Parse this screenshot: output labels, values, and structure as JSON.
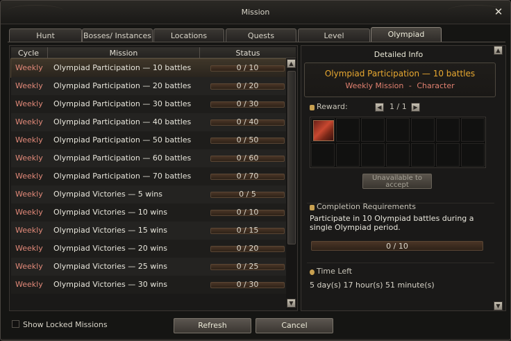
{
  "window": {
    "title": "Mission",
    "close_icon": "close-icon"
  },
  "tabs": [
    {
      "label": "Hunt",
      "active": false
    },
    {
      "label": "Bosses/ Instances",
      "active": false
    },
    {
      "label": "Locations",
      "active": false
    },
    {
      "label": "Quests",
      "active": false
    },
    {
      "label": "Level",
      "active": false
    },
    {
      "label": "Olympiad",
      "active": true
    }
  ],
  "table": {
    "columns": [
      "Cycle",
      "Mission",
      "Status"
    ],
    "rows": [
      {
        "cycle": "Weekly",
        "mission": "Olympiad Participation — 10 battles",
        "status": "0 / 10",
        "progress": 0
      },
      {
        "cycle": "Weekly",
        "mission": "Olympiad Participation — 20 battles",
        "status": "0 / 20",
        "progress": 0
      },
      {
        "cycle": "Weekly",
        "mission": "Olympiad Participation — 30 battles",
        "status": "0 / 30",
        "progress": 0
      },
      {
        "cycle": "Weekly",
        "mission": "Olympiad Participation — 40 battles",
        "status": "0 / 40",
        "progress": 0
      },
      {
        "cycle": "Weekly",
        "mission": "Olympiad Participation — 50 battles",
        "status": "0 / 50",
        "progress": 0
      },
      {
        "cycle": "Weekly",
        "mission": "Olympiad Participation — 60 battles",
        "status": "0 / 60",
        "progress": 0
      },
      {
        "cycle": "Weekly",
        "mission": "Olympiad Participation — 70 battles",
        "status": "0 / 70",
        "progress": 0
      },
      {
        "cycle": "Weekly",
        "mission": "Olympiad Victories — 5 wins",
        "status": "0 / 5",
        "progress": 0
      },
      {
        "cycle": "Weekly",
        "mission": "Olympiad Victories — 10 wins",
        "status": "0 / 10",
        "progress": 0
      },
      {
        "cycle": "Weekly",
        "mission": "Olympiad Victories — 15 wins",
        "status": "0 / 15",
        "progress": 0
      },
      {
        "cycle": "Weekly",
        "mission": "Olympiad Victories — 20 wins",
        "status": "0 / 20",
        "progress": 0
      },
      {
        "cycle": "Weekly",
        "mission": "Olympiad Victories — 25 wins",
        "status": "0 / 25",
        "progress": 0
      },
      {
        "cycle": "Weekly",
        "mission": "Olympiad Victories — 30 wins",
        "status": "0 / 30",
        "progress": 0
      }
    ],
    "selected_index": 0
  },
  "detail": {
    "header": "Detailed Info",
    "title": "Olympiad Participation — 10 battles",
    "subtitle_type": "Weekly Mission",
    "subtitle_sep": "-",
    "subtitle_target": "Character",
    "reward_label": "Reward:",
    "reward_page": "1 / 1",
    "accept_button": "Unavailable to accept",
    "completion_label": "Completion Requirements",
    "completion_text": "Participate in 10 Olympiad battles during a single Olympiad period.",
    "completion_status": "0 / 10",
    "completion_progress": 0,
    "time_left_label": "Time Left",
    "time_left_value": "5 day(s) 17 hour(s) 51 minute(s)"
  },
  "footer": {
    "show_locked_label": "Show Locked Missions",
    "show_locked_checked": false,
    "refresh_button": "Refresh",
    "cancel_button": "Cancel"
  },
  "colors": {
    "cycle": "#e08878",
    "detail_title": "#e8a830",
    "detail_subtitle": "#e08070"
  }
}
